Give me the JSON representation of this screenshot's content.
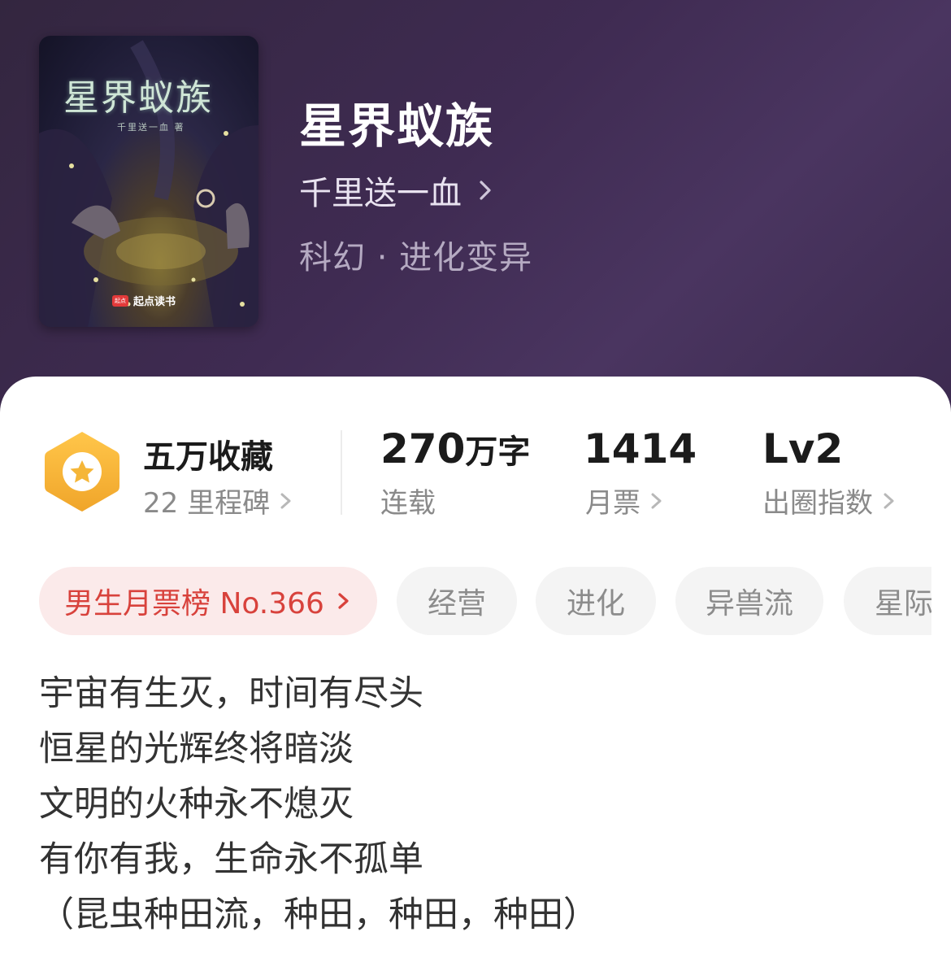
{
  "book": {
    "title": "星界蚁族",
    "author": "千里送一血",
    "genre": "科幻 · 进化变异",
    "cover": {
      "title": "星界蚁族",
      "subtitle": "千里送一血 著",
      "brand_logo": "起点",
      "brand": "起点读书"
    }
  },
  "stats": {
    "collect": {
      "label": "五万收藏",
      "sub": "22 里程碑"
    },
    "words": {
      "value": "270",
      "unit": "万字",
      "sub": "连载"
    },
    "votes": {
      "value": "1414",
      "sub": "月票"
    },
    "index": {
      "value": "Lv2",
      "sub": "出圈指数"
    }
  },
  "tags": [
    {
      "label": "男生月票榜 No.366"
    },
    {
      "label": "经营"
    },
    {
      "label": "进化"
    },
    {
      "label": "异兽流"
    },
    {
      "label": "星际"
    }
  ],
  "synopsis": [
    "宇宙有生灭，时间有尽头",
    "恒星的光辉终将暗淡",
    "文明的火种永不熄灭",
    "有你有我，生命永不孤单",
    "（昆虫种田流，种田，种田，种田）"
  ],
  "colors": {
    "header_bg": "#3f2b52",
    "rank_tag_text": "#d8423c",
    "rank_tag_bg": "#fbeaea",
    "medal": "#f5b638"
  },
  "icons": {
    "author_arrow": "chevron-right-icon",
    "medal": "star-medal-icon"
  }
}
